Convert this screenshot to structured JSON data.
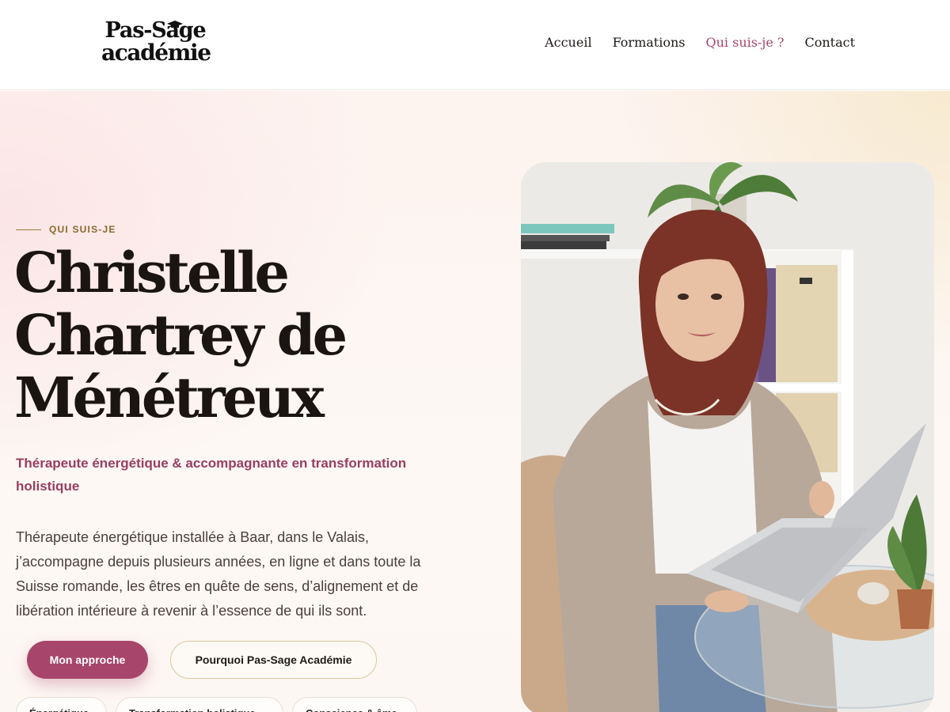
{
  "header": {
    "logo": {
      "line1": "Pas-Sage",
      "line2": "académie"
    },
    "nav": [
      {
        "label": "Accueil",
        "active": false
      },
      {
        "label": "Formations",
        "active": false
      },
      {
        "label": "Qui suis-je ?",
        "active": true
      },
      {
        "label": "Contact",
        "active": false
      }
    ]
  },
  "hero": {
    "eyebrow": "QUI SUIS-JE",
    "name_lines": [
      "Christelle",
      "Chartrey de",
      "Ménétreux"
    ],
    "subtitle": "Thérapeute énergétique & accompagnante en transformation holistique",
    "intro": "Thérapeute énergétique installée à Baar, dans le Valais, j’accompagne depuis plusieurs années, en ligne et dans toute la Suisse romande, les êtres en quête de sens, d’alignement et de libération intérieure à revenir à l’essence de qui ils sont.",
    "primary_button": "Mon approche",
    "secondary_button": "Pourquoi Pas-Sage Académie",
    "tags": [
      "Énergétique",
      "Transformation holistique",
      "Conscience & âme"
    ]
  },
  "colors": {
    "accent": "#a8456a",
    "eyebrow": "#8a6a2e",
    "heading": "#1a1512",
    "body_text": "#4a3f3a"
  },
  "photo": {
    "alt_icon": "portrait-photo"
  }
}
